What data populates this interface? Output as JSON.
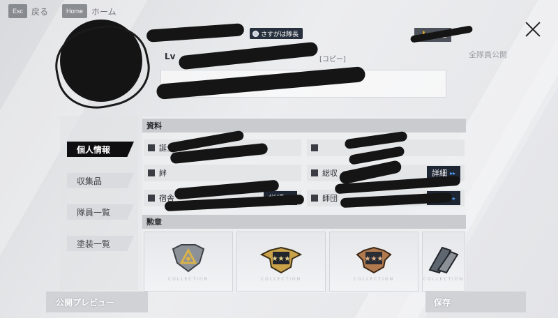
{
  "nav": {
    "esc_key": "Esc",
    "back_label": "戻る",
    "home_key": "Home",
    "home_label": "ホーム"
  },
  "profile": {
    "title_badge": "さすがは隊長",
    "level_prefix": "Lv",
    "copy_label": "[コピー]",
    "likes": "202",
    "visibility": "全隊員公開"
  },
  "sidebar": {
    "items": [
      {
        "label": "個人情報",
        "active": true
      },
      {
        "label": "収集品",
        "active": false
      },
      {
        "label": "隊員一覧",
        "active": false
      },
      {
        "label": "塗装一覧",
        "active": false
      }
    ]
  },
  "info_section": {
    "title": "資料",
    "rows": [
      {
        "label": "誕生日",
        "icon": "calendar-icon"
      },
      {
        "label": "",
        "icon": "flag-icon"
      },
      {
        "label": "絆",
        "icon": "bond-icon"
      },
      {
        "label": "総収",
        "icon": "collection-icon"
      },
      {
        "label": "宿舎",
        "icon": "home-icon"
      },
      {
        "label": "師団",
        "icon": "shield-icon"
      }
    ],
    "detail_label": "詳細",
    "detail_arrow": "▸▸"
  },
  "medal_section": {
    "title": "勲章",
    "caption": "COLLECTION",
    "medals": [
      {
        "name": "silver-triangle-medal",
        "color": "#8c9097"
      },
      {
        "name": "gold-star-medal",
        "color": "#c9a24a"
      },
      {
        "name": "bronze-star-medal",
        "color": "#b07a4e"
      },
      {
        "name": "winged-medal",
        "color": "#5f6670"
      }
    ]
  },
  "footer": {
    "preview_label": "公開プレビュー",
    "save_label": "保存"
  }
}
